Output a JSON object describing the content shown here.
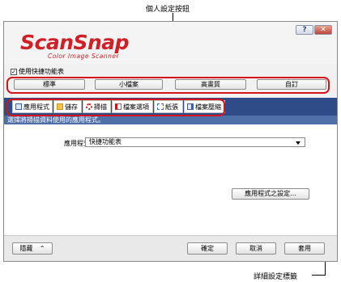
{
  "annotations": {
    "profile_buttons_label": "個人設定按鈕",
    "detail_tabs_label": "詳細設定標籤"
  },
  "window": {
    "help_button": "?",
    "close_button": "✕",
    "logo_text": "ScanSnap",
    "logo_subtext": "Color Image Scanner"
  },
  "quick_menu": {
    "label": "使用快捷功能表",
    "checked": true
  },
  "profiles": [
    "標準",
    "小檔案",
    "高畫質",
    "自訂"
  ],
  "tabs": [
    {
      "label": "應用程式",
      "icon": "application-icon"
    },
    {
      "label": "儲存",
      "icon": "folder-icon"
    },
    {
      "label": "掃描",
      "icon": "scan-icon"
    },
    {
      "label": "檔案選項",
      "icon": "file-option-icon"
    },
    {
      "label": "紙張",
      "icon": "paper-icon"
    },
    {
      "label": "檔案壓縮",
      "icon": "compression-icon"
    }
  ],
  "content": {
    "instruction": "選擇將掃描資料使用的應用程式。",
    "application_label": "應用程式：",
    "application_value": "快捷功能表",
    "app_settings_button": "應用程式之設定..."
  },
  "footer": {
    "hide_button": "隱藏",
    "hide_arrow": "⌃",
    "ok_button": "確定",
    "cancel_button": "取消",
    "apply_button": "套用"
  },
  "colors": {
    "accent_red": "#d4131b",
    "tab_band": "#2f4c88",
    "info_bar": "#4f6fa8"
  }
}
